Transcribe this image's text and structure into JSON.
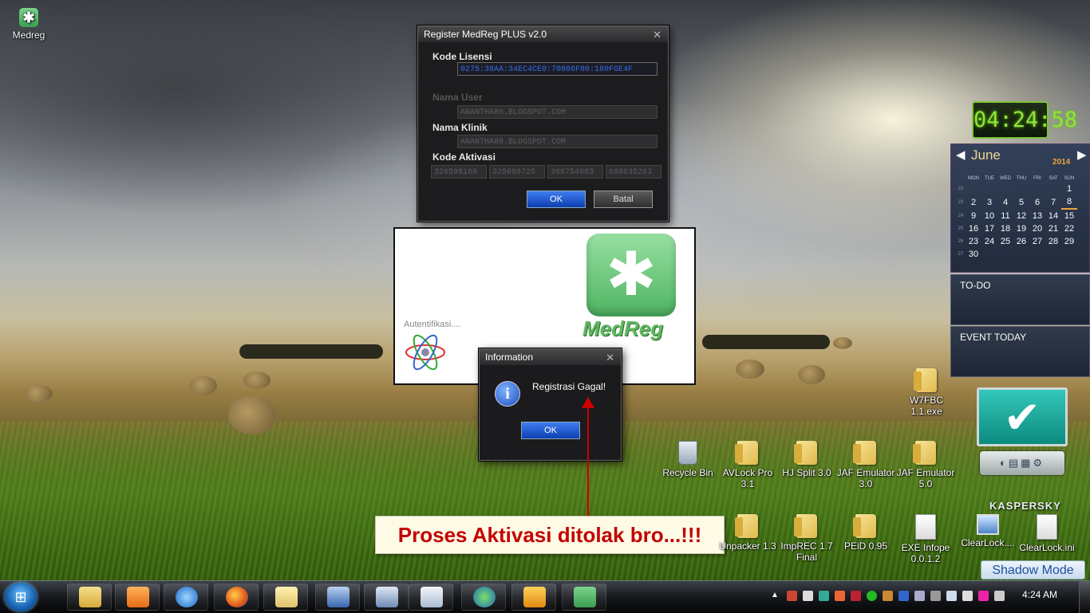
{
  "desktop": {
    "top_left_icon": {
      "label": "Medreg",
      "icon": "medreg-icon"
    },
    "icons": [
      {
        "label": "W7FBC 1.1.exe",
        "icon": "folder-icon"
      },
      {
        "label": "Recycle Bin",
        "icon": "recycle-bin-icon"
      },
      {
        "label": "AVLock Pro 3.1",
        "icon": "folder-icon"
      },
      {
        "label": "HJ Split 3.0",
        "icon": "folder-icon"
      },
      {
        "label": "JAF Emulator 3.0",
        "icon": "folder-icon"
      },
      {
        "label": "JAF Emulator 5.0",
        "icon": "folder-icon"
      },
      {
        "label": "Unpacker 1.3",
        "icon": "folder-icon"
      },
      {
        "label": "ImpREC 1.7 Final",
        "icon": "folder-icon"
      },
      {
        "label": "PEiD 0.95",
        "icon": "folder-icon"
      },
      {
        "label": "EXE Infope 0.0.1.2",
        "icon": "file-icon"
      },
      {
        "label": "ClearLock....",
        "icon": "clearlock-icon"
      },
      {
        "label": "ClearLock.ini",
        "icon": "ini-file-icon"
      }
    ]
  },
  "register_window": {
    "title": "Register MedReg PLUS v2.0",
    "kode_lisensi_label": "Kode Lisensi",
    "kode_lisensi_value": "0275:38AA:34EC4CE0:70806F80:180FGE4F",
    "nama_user_label": "Nama User",
    "nama_user_value": "ANANTHA88.BLOGSPOT.COM",
    "nama_klinik_label": "Nama Klinik",
    "nama_klinik_value": "ANANTHA88.BLOGSPOT.COM",
    "kode_aktivasi_label": "Kode Aktivasi",
    "kode_aktivasi_values": [
      "326598168",
      "325698725",
      "368754883",
      "689635263"
    ],
    "ok_label": "OK",
    "batal_label": "Batal"
  },
  "splash": {
    "status": "Autentifikasi....",
    "logo_text": "MedReg"
  },
  "info_dialog": {
    "title": "Information",
    "message": "Registrasi Gagal!",
    "ok_label": "OK"
  },
  "annotation": {
    "text": "Proses Aktivasi ditolak bro...!!!",
    "color": "#c40000"
  },
  "gadgets": {
    "clock": "04:24:58",
    "calendar": {
      "month": "June",
      "year": "2014",
      "day_headers": [
        "MON",
        "TUE",
        "WED",
        "THU",
        "FRI",
        "SAT",
        "SUN"
      ],
      "weeks": [
        {
          "wk": "22",
          "days": [
            "",
            "",
            "",
            "",
            "",
            "",
            "1"
          ]
        },
        {
          "wk": "23",
          "days": [
            "2",
            "3",
            "4",
            "5",
            "6",
            "7",
            "8"
          ]
        },
        {
          "wk": "24",
          "days": [
            "9",
            "10",
            "11",
            "12",
            "13",
            "14",
            "15"
          ]
        },
        {
          "wk": "25",
          "days": [
            "16",
            "17",
            "18",
            "19",
            "20",
            "21",
            "22"
          ]
        },
        {
          "wk": "26",
          "days": [
            "23",
            "24",
            "25",
            "26",
            "27",
            "28",
            "29"
          ]
        },
        {
          "wk": "27",
          "days": [
            "30",
            "",
            "",
            "",
            "",
            "",
            ""
          ]
        }
      ],
      "today": "8"
    },
    "todo_label": "TO-DO",
    "event_label": "EVENT TODAY",
    "kaspersky_label": "KASPERSKY",
    "shadow_mode_label": "Shadow Mode"
  },
  "taskbar": {
    "items": [
      "explorer-icon",
      "media-player-icon",
      "internet-explorer-icon",
      "firefox-icon",
      "notepad-icon",
      "computer-icon",
      "windows-icon",
      "paper-icon",
      "globe-icon",
      "music-icon",
      "medreg-icon"
    ],
    "time": "4:24 AM"
  }
}
